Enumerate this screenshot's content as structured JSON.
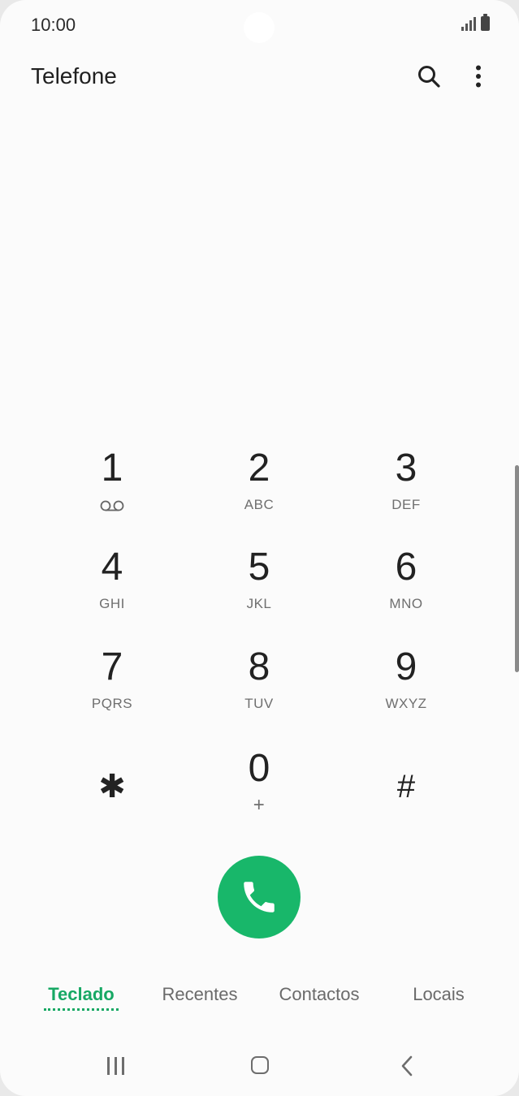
{
  "status": {
    "time": "10:00"
  },
  "header": {
    "title": "Telefone"
  },
  "dialpad": [
    {
      "digit": "1",
      "letters": ""
    },
    {
      "digit": "2",
      "letters": "ABC"
    },
    {
      "digit": "3",
      "letters": "DEF"
    },
    {
      "digit": "4",
      "letters": "GHI"
    },
    {
      "digit": "5",
      "letters": "JKL"
    },
    {
      "digit": "6",
      "letters": "MNO"
    },
    {
      "digit": "7",
      "letters": "PQRS"
    },
    {
      "digit": "8",
      "letters": "TUV"
    },
    {
      "digit": "9",
      "letters": "WXYZ"
    },
    {
      "digit": "✱",
      "letters": ""
    },
    {
      "digit": "0",
      "letters": "+"
    },
    {
      "digit": "#",
      "letters": ""
    }
  ],
  "tabs": [
    "Teclado",
    "Recentes",
    "Contactos",
    "Locais"
  ],
  "active_tab": "Teclado",
  "colors": {
    "accent": "#17a864",
    "call": "#18b76a"
  }
}
